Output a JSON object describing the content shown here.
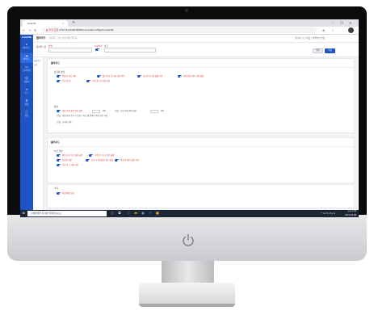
{
  "browser": {
    "tab_title": "LinaTik",
    "tab_close": "×",
    "new_tab": "+",
    "win_min": "–",
    "win_max": "❐",
    "win_close": "✕",
    "security_warning": "▲ 주의 요함",
    "url": "172.16.10.80:8080/console/config/cloud/edit",
    "menu_dots": "⋮"
  },
  "app": {
    "logo": "LinaTik",
    "page_title": "클라우드",
    "breadcrumb": "클라우드 관리 설정 화면 입니다.",
    "topbar_right": "관리자 | 로그아웃 | 비밀번호 변경",
    "sidebar": [
      {
        "icon": "home-icon",
        "glyph": "⌂",
        "label": "대시보드"
      },
      {
        "icon": "cloud-icon",
        "glyph": "☁",
        "label": "클라우드",
        "active": true
      },
      {
        "icon": "monitor-icon",
        "glyph": "▭",
        "label": "모니터링"
      },
      {
        "icon": "user-icon",
        "glyph": "☺",
        "label": "사용자"
      },
      {
        "icon": "list-icon",
        "glyph": "≡",
        "label": "로그"
      },
      {
        "icon": "gear-icon",
        "glyph": "⚙",
        "label": "설정"
      },
      {
        "icon": "info-icon",
        "glyph": "ⓘ",
        "label": "정보"
      }
    ],
    "left_panel": [
      "클라우드",
      "설정"
    ],
    "filter": {
      "field1_label": "클라우드명",
      "field2_label": "설명",
      "field3_label": "사용여부",
      "field4_label": "비고",
      "cancel_label": "취소",
      "save_label": "저장"
    }
  },
  "card1": {
    "title": "클라우드",
    "group1_title": "동기화 설정",
    "toggles_row1": [
      {
        "label": "파일 동기화 사용",
        "on": true
      },
      {
        "label": "폴더 자동 동기화 사용 여부",
        "on": true
      },
      {
        "label": "실시간 동기화 설정 사용",
        "on": true
      },
      {
        "label": "파일 버전 관리 사용 설정",
        "on": true
      }
    ],
    "toggles_row2": [
      {
        "label": "자동 업로드",
        "on": true
      },
      {
        "label": "공유 폴더 동기화 허용",
        "on": true
      }
    ],
    "group2_title": "용량",
    "quota_row": [
      {
        "label": "개인 저장 용량 제한 설정",
        "on": true,
        "unit": "GB"
      },
      {
        "label": "공유 저장 용량 제한",
        "on": false,
        "unit": "GB"
      }
    ],
    "extra_rows": [
      {
        "label": "저장 용량 초과 시 업로드 차단 및 관리자 알림 전송 사용",
        "on": false
      },
      {
        "label": "휴지통 사용",
        "on": false
      }
    ]
  },
  "card2": {
    "title": "클라우드",
    "group1_title": "보안 설정",
    "toggles_row1": [
      {
        "label": "외부 공유 링크 생성 허용",
        "on": true
      },
      {
        "label": "다운로드 링크 만료 설정",
        "on": true
      }
    ],
    "toggles_row2": [
      {
        "label": "암호화 저장",
        "on": true
      },
      {
        "label": "공유 시 비밀번호 필수 설정",
        "on": true
      },
      {
        "label": "접속 IP 제한 설정 사용",
        "on": true
      }
    ],
    "toggles_row3": [
      {
        "label": "감사 로그 기록 사용",
        "on": true
      }
    ],
    "group2_title": "기타",
    "toggles_row4": [
      {
        "label": "알림 메일 발송",
        "on": true
      }
    ]
  },
  "taskbar": {
    "search_placeholder": "검색하려면 여기에 입력하십시오.",
    "tray": "^ ⊡ ㅁ 4)) A",
    "time": "오후 1:23",
    "date": "2021-03-08"
  }
}
